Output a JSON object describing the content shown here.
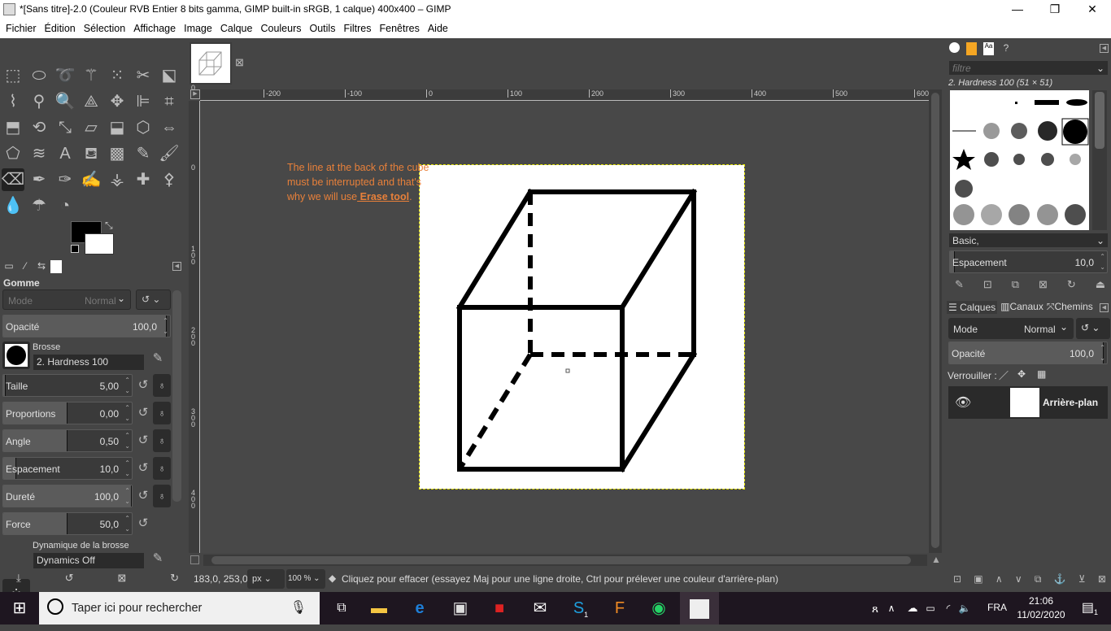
{
  "window": {
    "title": "*[Sans titre]-2.0 (Couleur RVB Entier 8 bits gamma, GIMP built-in sRGB, 1 calque) 400x400 – GIMP",
    "minimize": "—",
    "maximize": "❐",
    "close": "✕"
  },
  "menu": [
    "Fichier",
    "Édition",
    "Sélection",
    "Affichage",
    "Image",
    "Calque",
    "Couleurs",
    "Outils",
    "Filtres",
    "Fenêtres",
    "Aide"
  ],
  "toolbox": {
    "tools": [
      "rect-select",
      "ellipse-select",
      "free-select",
      "fuzzy-select",
      "select-by-color",
      "scissors-select",
      "foreground-select",
      "paths",
      "color-picker",
      "zoom",
      "measure",
      "move",
      "align",
      "crop",
      "unified-transform",
      "rotate",
      "scale",
      "shear",
      "handle-transform",
      "perspective",
      "flip",
      "cage-transform",
      "warp-transform",
      "text",
      "bucket-fill",
      "blend",
      "pencil",
      "paintbrush",
      "eraser",
      "airbrush",
      "ink",
      "mypaint-brush",
      "clone",
      "heal",
      "perspective-clone",
      "smudge",
      "blur-sharpen",
      "dodge-burn"
    ],
    "active_tool": "eraser",
    "foreground_color": "#000000",
    "background_color": "#ffffff"
  },
  "tool_options": {
    "title": "Gomme",
    "mode_label": "Mode",
    "mode_value": "Normal",
    "opacity": {
      "label": "Opacité",
      "value": "100,0"
    },
    "brush_label": "Brosse",
    "brush_value": "2. Hardness 100",
    "sliders": [
      {
        "label": "Taille",
        "value": "5,00",
        "fill": 0.02,
        "chain": true
      },
      {
        "label": "Proportions",
        "value": "0,00",
        "fill": 0.5,
        "chain": true
      },
      {
        "label": "Angle",
        "value": "0,50",
        "fill": 0.5,
        "chain": true
      },
      {
        "label": "Espacement",
        "value": "10,0",
        "fill": 0.1,
        "chain": true
      },
      {
        "label": "Dureté",
        "value": "100,0",
        "fill": 1.0,
        "chain": true
      },
      {
        "label": "Force",
        "value": "50,0",
        "fill": 0.5,
        "chain": false
      }
    ],
    "dynamics_label": "Dynamique de la brosse",
    "dynamics_value": "Dynamics Off"
  },
  "image_tab": {
    "close": "⊠"
  },
  "rulers": {
    "top": [
      "-200",
      "-100",
      "0",
      "100",
      "200",
      "300",
      "400",
      "500",
      "600"
    ],
    "left": [
      "0",
      "0",
      "1\n0\n0",
      "2\n0\n0",
      "3\n0\n0",
      "4\n0\n0"
    ]
  },
  "annotation": {
    "line1": "The line at the back of the cube",
    "line2": "must be interrupted and that's",
    "line3_prefix": "why we will use",
    "line3_link": " Erase tool",
    "line3_suffix": ".",
    "color": "#e8803a"
  },
  "status": {
    "coords": "183,0, 253,0",
    "unit": "px",
    "zoom": "100 %",
    "message": "Cliquez pour effacer (essayez Maj pour une ligne droite, Ctrl pour prélever une couleur d'arrière-plan)"
  },
  "brushes": {
    "filter_placeholder": "filtre",
    "selected": "2. Hardness 100 (51 × 51)",
    "tag": "Basic,",
    "spacing_label": "Espacement",
    "spacing_value": "10,0"
  },
  "layers": {
    "tabs": [
      "Calques",
      "Canaux",
      "Chemins"
    ],
    "mode_label": "Mode",
    "mode_value": "Normal",
    "opacity_label": "Opacité",
    "opacity_value": "100,0",
    "lock_label": "Verrouiller :",
    "items": [
      {
        "name": "Arrière-plan",
        "visible": true
      }
    ]
  },
  "taskbar": {
    "search_placeholder": "Taper ici pour rechercher",
    "lang": "FRA",
    "time": "21:06",
    "date": "11/02/2020",
    "skype_badge": "1",
    "notif_badge": "1"
  }
}
